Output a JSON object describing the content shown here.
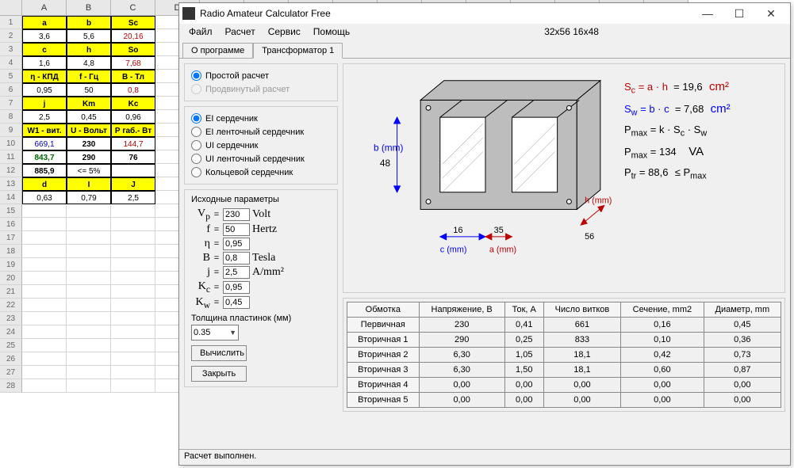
{
  "spreadsheet": {
    "cols": [
      "A",
      "B",
      "C",
      "D",
      "E",
      "F",
      "G",
      "H",
      "I",
      "J",
      "K",
      "L",
      "M",
      "N",
      "O"
    ],
    "rows": 28,
    "data": {
      "1": [
        "a",
        "b",
        "Sc"
      ],
      "2": [
        "3,6",
        "5,6",
        "20,16"
      ],
      "3": [
        "c",
        "h",
        "So"
      ],
      "4": [
        "1,6",
        "4,8",
        "7,68"
      ],
      "5": [
        "η - КПД",
        "f - Гц",
        "В - Тл"
      ],
      "6": [
        "0,95",
        "50",
        "0,8"
      ],
      "7": [
        "j",
        "Km",
        "Kc"
      ],
      "8": [
        "2,5",
        "0,45",
        "0,96"
      ],
      "9": [
        "W1 - вит.",
        "U - Вольт",
        "Р габ.- Вт"
      ],
      "10": [
        "669,1",
        "230",
        "144,7"
      ],
      "11": [
        "843,7",
        "290",
        "76"
      ],
      "12": [
        "885,9",
        "<= 5%",
        ""
      ],
      "13": [
        "d",
        "I",
        "J"
      ],
      "14": [
        "0,63",
        "0,79",
        "2,5"
      ]
    },
    "styles": {
      "2_C": "red",
      "4_C": "red",
      "6_C": "red",
      "10_C": "red",
      "10_A": "blue",
      "10_B": "bold",
      "11_A": "grn",
      "11_B": "bold",
      "11_C": "bold",
      "12_A": "bold"
    }
  },
  "app": {
    "title": "Radio Amateur Calculator Free",
    "menus": [
      "Файл",
      "Расчет",
      "Сервис",
      "Помощь"
    ],
    "center_text": "32x56 16x48",
    "tabs": [
      {
        "label": "О программе",
        "active": false
      },
      {
        "label": "Трансформатор 1",
        "active": true
      }
    ],
    "calc_mode": {
      "simple": "Простой расчет",
      "advanced": "Продвинутый расчет"
    },
    "core_types": {
      "ei": "EI сердечник",
      "ei_tape": "EI ленточный сердечник",
      "ui": "UI сердечник",
      "ui_tape": "UI ленточный сердечник",
      "ring": "Кольцевой сердечник"
    },
    "params_title": "Исходные параметры",
    "params": {
      "Vp": {
        "label": "Vp",
        "value": "230",
        "unit": "Volt"
      },
      "f": {
        "label": "f",
        "value": "50",
        "unit": "Hertz"
      },
      "eta": {
        "label": "η",
        "value": "0,95",
        "unit": ""
      },
      "B": {
        "label": "B",
        "value": "0,8",
        "unit": "Tesla"
      },
      "j": {
        "label": "j",
        "value": "2,5",
        "unit": "A/mm²"
      },
      "Kc": {
        "label": "Kc",
        "value": "0,95",
        "unit": ""
      },
      "Kw": {
        "label": "Kw",
        "value": "0,45",
        "unit": ""
      }
    },
    "thickness_label": "Толщина пластинок (мм)",
    "thickness_value": "0.35",
    "btn_calc": "Вычислить",
    "btn_close": "Закрыть",
    "diagram": {
      "b_label": "b (mm)",
      "b_val": "48",
      "c_label": "c (mm)",
      "c_val": "16",
      "a_label": "a (mm)",
      "a_val": "35",
      "h_label": "h (mm)",
      "h_val": "56"
    },
    "formulas": {
      "sc": {
        "lhs": "Sc = a · h",
        "val": "19,6",
        "unit": "cm²"
      },
      "sw": {
        "lhs": "Sw = b · c",
        "val": "7,68",
        "unit": "cm²"
      },
      "pmax1": {
        "lhs": "Pmax = k · Sc · Sw"
      },
      "pmax2": {
        "lhs": "Pmax =",
        "val": "134",
        "unit": "VA"
      },
      "ptr": {
        "lhs": "Ptr =",
        "val": "88,6",
        "rhs": "≤ Pmax"
      }
    },
    "table": {
      "headers": [
        "Обмотка",
        "Напряжение, В",
        "Ток, А",
        "Число витков",
        "Сечение, mm2",
        "Диаметр, mm"
      ],
      "rows": [
        [
          "Первичная",
          "230",
          "0,41",
          "661",
          "0,16",
          "0,45"
        ],
        [
          "Вторичная 1",
          "290",
          "0,25",
          "833",
          "0,10",
          "0,36"
        ],
        [
          "Вторичная 2",
          "6,30",
          "1,05",
          "18,1",
          "0,42",
          "0,73"
        ],
        [
          "Вторичная 3",
          "6,30",
          "1,50",
          "18,1",
          "0,60",
          "0,87"
        ],
        [
          "Вторичная 4",
          "0,00",
          "0,00",
          "0,00",
          "0,00",
          "0,00"
        ],
        [
          "Вторичная 5",
          "0,00",
          "0,00",
          "0,00",
          "0,00",
          "0,00"
        ]
      ]
    },
    "status": "Расчет выполнен."
  },
  "chart_data": {
    "type": "table",
    "title": "Transformer windings",
    "columns": [
      "Обмотка",
      "Напряжение, В",
      "Ток, А",
      "Число витков",
      "Сечение, mm2",
      "Диаметр, mm"
    ],
    "rows": [
      [
        "Первичная",
        230,
        0.41,
        661,
        0.16,
        0.45
      ],
      [
        "Вторичная 1",
        290,
        0.25,
        833,
        0.1,
        0.36
      ],
      [
        "Вторичная 2",
        6.3,
        1.05,
        18.1,
        0.42,
        0.73
      ],
      [
        "Вторичная 3",
        6.3,
        1.5,
        18.1,
        0.6,
        0.87
      ],
      [
        "Вторичная 4",
        0.0,
        0.0,
        0.0,
        0.0,
        0.0
      ],
      [
        "Вторичная 5",
        0.0,
        0.0,
        0.0,
        0.0,
        0.0
      ]
    ]
  }
}
